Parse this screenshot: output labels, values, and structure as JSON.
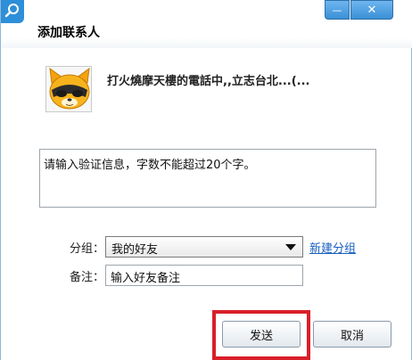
{
  "window": {
    "title": "添加联系人",
    "controls": {
      "minimize": "—",
      "close": "✕"
    }
  },
  "contact": {
    "name": "打火燒摩天樓的電話中,,立志台北...(..."
  },
  "verify": {
    "text": "请输入验证信息，字数不能超过20个字。"
  },
  "group": {
    "label": "分组：",
    "selected": "我的好友",
    "new_group_link": "新建分组"
  },
  "remark": {
    "label": "备注：",
    "value": "输入好友备注"
  },
  "buttons": {
    "send": "发送",
    "cancel": "取消"
  },
  "colors": {
    "accent": "#2d8fd8",
    "link": "#1a5fc0",
    "highlight": "#d91f2a"
  }
}
